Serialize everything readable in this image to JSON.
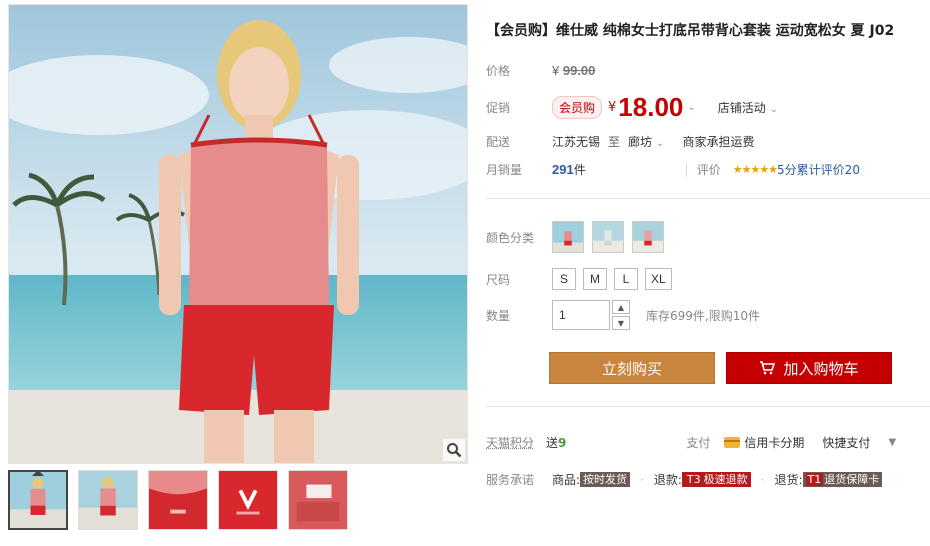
{
  "product": {
    "title": "【会员购】维仕威 纯棉女士打底吊带背心套装 运动宽松女 夏 J02"
  },
  "price": {
    "label": "价格",
    "symbol": "¥",
    "original": "99.00"
  },
  "promo": {
    "label": "促销",
    "badge": "会员购",
    "symbol": "¥",
    "current": "18.00",
    "shop_promo": "店铺活动"
  },
  "shipping": {
    "label": "配送",
    "from": "江苏无锡",
    "to_word": "至",
    "dest": "廊坊",
    "fee": "商家承担运费"
  },
  "sales": {
    "label": "月销量",
    "count": "291",
    "unit": "件",
    "review_label": "评价",
    "stars": "★★★★★",
    "rating": 5,
    "review_text": "5分累计评价20"
  },
  "options": {
    "color_label": "颜色分类",
    "color_swatches": [
      "swatch-1",
      "swatch-2",
      "swatch-3"
    ],
    "size_label": "尺码",
    "sizes": [
      "S",
      "M",
      "L",
      "XL"
    ],
    "qty_label": "数量",
    "qty_value": "1",
    "stock": "库存699件,限购10件"
  },
  "actions": {
    "buy_now": "立刻购买",
    "add_to_cart": "加入购物车"
  },
  "rewards": {
    "points_label": "天猫积分",
    "gift_prefix": "送",
    "gift_value": "9",
    "pay_label": "支付",
    "card_installment": "信用卡分期",
    "fast_pay": "快捷支付"
  },
  "service": {
    "label": "服务承诺",
    "items": [
      {
        "key": "商品:",
        "code": "",
        "tag": "按时发货"
      },
      {
        "key": "退款:",
        "code": "T3",
        "tag": "极速退款"
      },
      {
        "key": "退货:",
        "code": "T1",
        "tag": "退货保障卡"
      }
    ]
  },
  "colors": {
    "price_red": "#c40000",
    "buy_button": "#c9853d",
    "cart_button": "#c40000"
  }
}
